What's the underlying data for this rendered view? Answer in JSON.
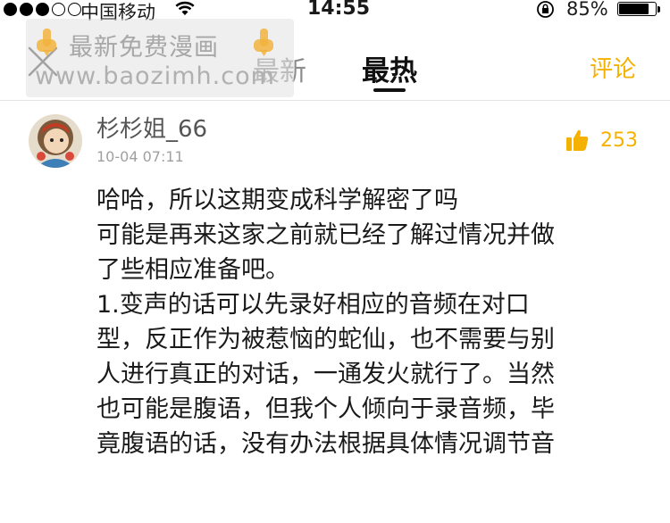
{
  "status_bar": {
    "carrier": "中国移动",
    "time": "14:55",
    "battery_percent": "85%",
    "battery_level": 0.85,
    "signal_bars_filled": 3,
    "signal_bars_total": 5
  },
  "nav": {
    "tabs": [
      {
        "label": "最新",
        "active": false
      },
      {
        "label": "最热",
        "active": true
      }
    ],
    "comment_label": "评论",
    "accent_color": "#f5b100"
  },
  "watermark": {
    "title": "最新免费漫画",
    "url": "www.baozimh.com"
  },
  "comment": {
    "username": "杉杉姐_66",
    "timestamp": "10-04 07:11",
    "likes": "253",
    "lines": [
      "哈哈，所以这期变成科学解密了吗",
      "可能是再来这家之前就已经了解过情况并做",
      "了些相应准备吧。",
      "1.变声的话可以先录好相应的音频在对口",
      "型，反正作为被惹恼的蛇仙，也不需要与别",
      "人进行真正的对话，一通发火就行了。当然",
      "也可能是腹语，但我个人倾向于录音频，毕",
      "竟腹语的话，没有办法根据具体情况调节音"
    ]
  }
}
